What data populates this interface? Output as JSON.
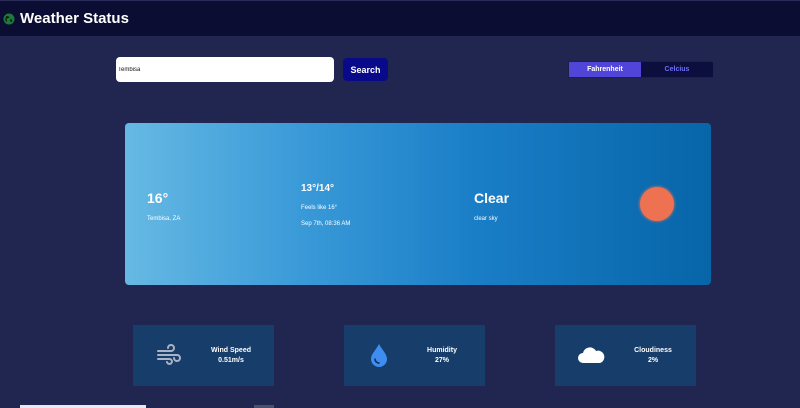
{
  "header": {
    "title": "Weather Status",
    "logo_icon": "globe-icon"
  },
  "search": {
    "value": "Tembisa",
    "button_label": "Search"
  },
  "units": {
    "options": [
      "Fahrenheit",
      "Celcius"
    ],
    "active": "Fahrenheit"
  },
  "current": {
    "temperature": "16°",
    "location": "Tembisa, ZA",
    "min_max": "13°/14°",
    "feels_like": "Feels like 16°",
    "datetime": "Sep 7th, 08:36 AM",
    "condition": "Clear",
    "description": "clear sky",
    "icon": "sun-icon"
  },
  "stats": [
    {
      "label": "Wind Speed",
      "value": "0.51m/s",
      "icon": "wind-icon"
    },
    {
      "label": "Humidity",
      "value": "27%",
      "icon": "water-drop-icon"
    },
    {
      "label": "Cloudiness",
      "value": "2%",
      "icon": "cloud-icon"
    }
  ],
  "colors": {
    "background": "#212651",
    "topbar": "#0c0d33",
    "search_button": "#090a8a",
    "unit_active": "#5045d8",
    "unit_inactive_text": "#6e6ef2",
    "stat_card": "#173e6a",
    "sun": "#ee7252"
  }
}
